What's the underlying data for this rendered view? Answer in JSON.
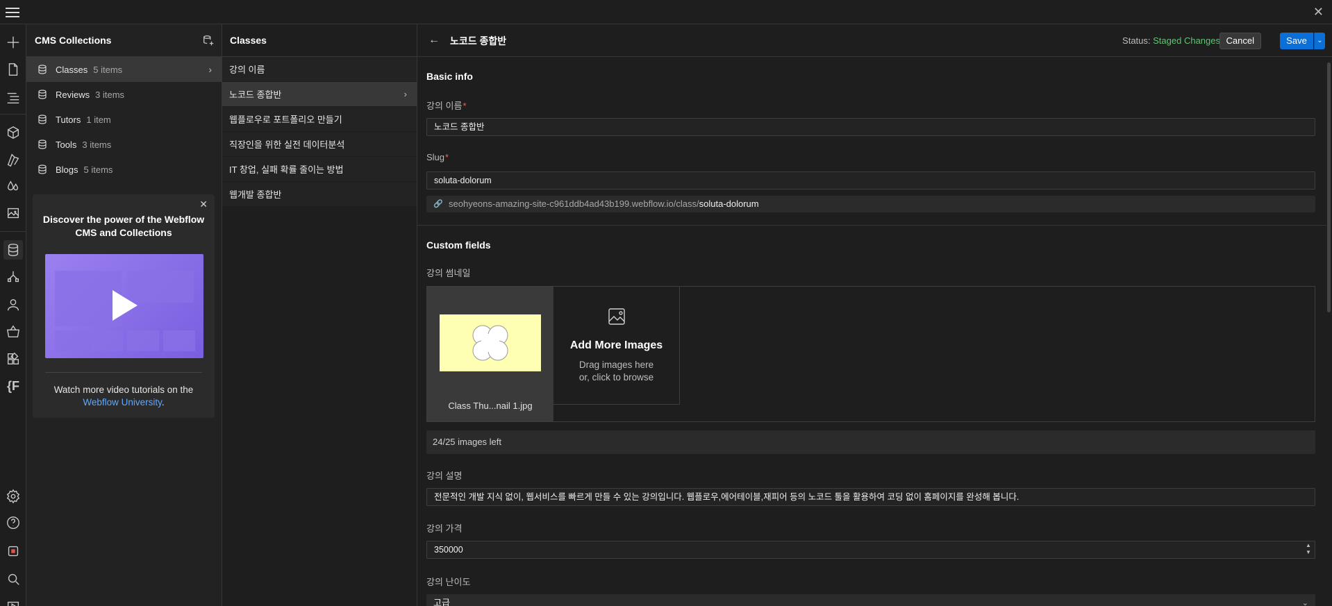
{
  "cms": {
    "title": "CMS Collections",
    "collections": [
      {
        "name": "Classes",
        "count": "5 items"
      },
      {
        "name": "Reviews",
        "count": "3 items"
      },
      {
        "name": "Tutors",
        "count": "1 item"
      },
      {
        "name": "Tools",
        "count": "3 items"
      },
      {
        "name": "Blogs",
        "count": "5 items"
      }
    ],
    "promo": {
      "title": "Discover the power of the Webflow CMS and Collections",
      "foot_text": "Watch more video tutorials on the",
      "link": "Webflow University",
      "period": "."
    }
  },
  "classes": {
    "title": "Classes",
    "items": [
      "강의 이름",
      "노코드 종합반",
      "웹플로우로 포트폴리오 만들기",
      "직장인을 위한 실전 데이터분석",
      "IT 창업, 실패 확률 줄이는 방법",
      "웹개발 종합반"
    ]
  },
  "editor": {
    "back_glyph": "←",
    "title": "노코드 종합반",
    "status_label": "Status:",
    "status_value": "Staged Changes",
    "cancel": "Cancel",
    "save": "Save",
    "basic_info": "Basic info",
    "name_label": "강의 이름",
    "name_value": "노코드 종합반",
    "slug_label": "Slug",
    "slug_value": "soluta-dolorum",
    "slug_url_prefix": "seohyeons-amazing-site-c961ddb4ad43b199.webflow.io/class/",
    "slug_url_end": "soluta-dolorum",
    "custom_fields": "Custom fields",
    "thumb_label": "강의 썸네일",
    "image_name": "Class Thu...nail 1.jpg",
    "add_images_title": "Add More Images",
    "add_images_sub1": "Drag images here",
    "add_images_sub2": "or, click to browse",
    "images_left": "24/25 images left",
    "desc_label": "강의 설명",
    "desc_value": "전문적인 개발 지식 없이, 웹서비스를 빠르게 만들 수 있는 강의입니다. 웹플로우,에어테이블,재피어 등의 노코드 툴을 활용하여 코딩 없이 홈페이지를 완성해 봅니다.",
    "price_label": "강의 가격",
    "price_value": "350000",
    "level_label": "강의 난이도",
    "level_value": "고급"
  },
  "colors": {
    "accent": "#0a6fd8",
    "status_green": "#62c474",
    "required": "#ff5a5a"
  }
}
